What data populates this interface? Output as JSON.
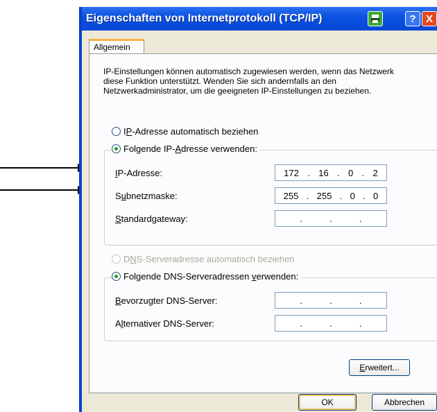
{
  "window": {
    "title": "Eigenschaften von Internetprotokoll (TCP/IP)",
    "help_label": "?",
    "close_label": "X"
  },
  "tabs": [
    {
      "label": "Allgemein"
    }
  ],
  "intro_text": "IP-Einstellungen können automatisch zugewiesen werden, wenn das Netzwerk diese Funktion unterstützt. Wenden Sie sich andernfalls an den Netzwerkadministrator, um die geeigneten IP-Einstellungen zu beziehen.",
  "ip_section": {
    "auto_option": {
      "before": "I",
      "key": "P",
      "after": "-Adresse automatisch beziehen",
      "selected": false
    },
    "manual_option": {
      "before": "Folgende IP-",
      "key": "A",
      "after": "dresse verwenden:",
      "selected": true
    },
    "fields": [
      {
        "label_key": "I",
        "label_rest": "P-Adresse:",
        "octets": [
          "172",
          "16",
          "0",
          "2"
        ]
      },
      {
        "label_before": "S",
        "label_key": "u",
        "label_rest": "bnetzmaske:",
        "octets": [
          "255",
          "255",
          "0",
          "0"
        ]
      },
      {
        "label_key": "S",
        "label_rest": "tandardgateway:",
        "octets": [
          "",
          "",
          "",
          ""
        ]
      }
    ]
  },
  "dns_section": {
    "auto_option": {
      "before": "D",
      "key": "N",
      "after": "S-Serveradresse automatisch beziehen",
      "selected": false,
      "disabled": true
    },
    "manual_option": {
      "before": "Folgende DNS-Serveradressen ",
      "key": "v",
      "after": "erwenden:",
      "selected": true
    },
    "fields": [
      {
        "label_key": "B",
        "label_rest": "evorzugter DNS-Server:",
        "octets": [
          "",
          "",
          "",
          ""
        ]
      },
      {
        "label_before": "A",
        "label_key": "l",
        "label_rest": "ternativer DNS-Server:",
        "octets": [
          "",
          "",
          "",
          ""
        ]
      }
    ]
  },
  "buttons": {
    "advanced": {
      "key": "E",
      "rest": "rweitert..."
    },
    "ok": "OK",
    "cancel": "Abbrechen"
  },
  "colors": {
    "titlebar": "#0a53e0",
    "dialog_bg": "#ece9d8",
    "tab_accent": "#f6b140",
    "radio_dot": "#21a121"
  },
  "icons": [
    "printer-icon",
    "help-icon",
    "close-icon",
    "arrow-right-icon"
  ]
}
